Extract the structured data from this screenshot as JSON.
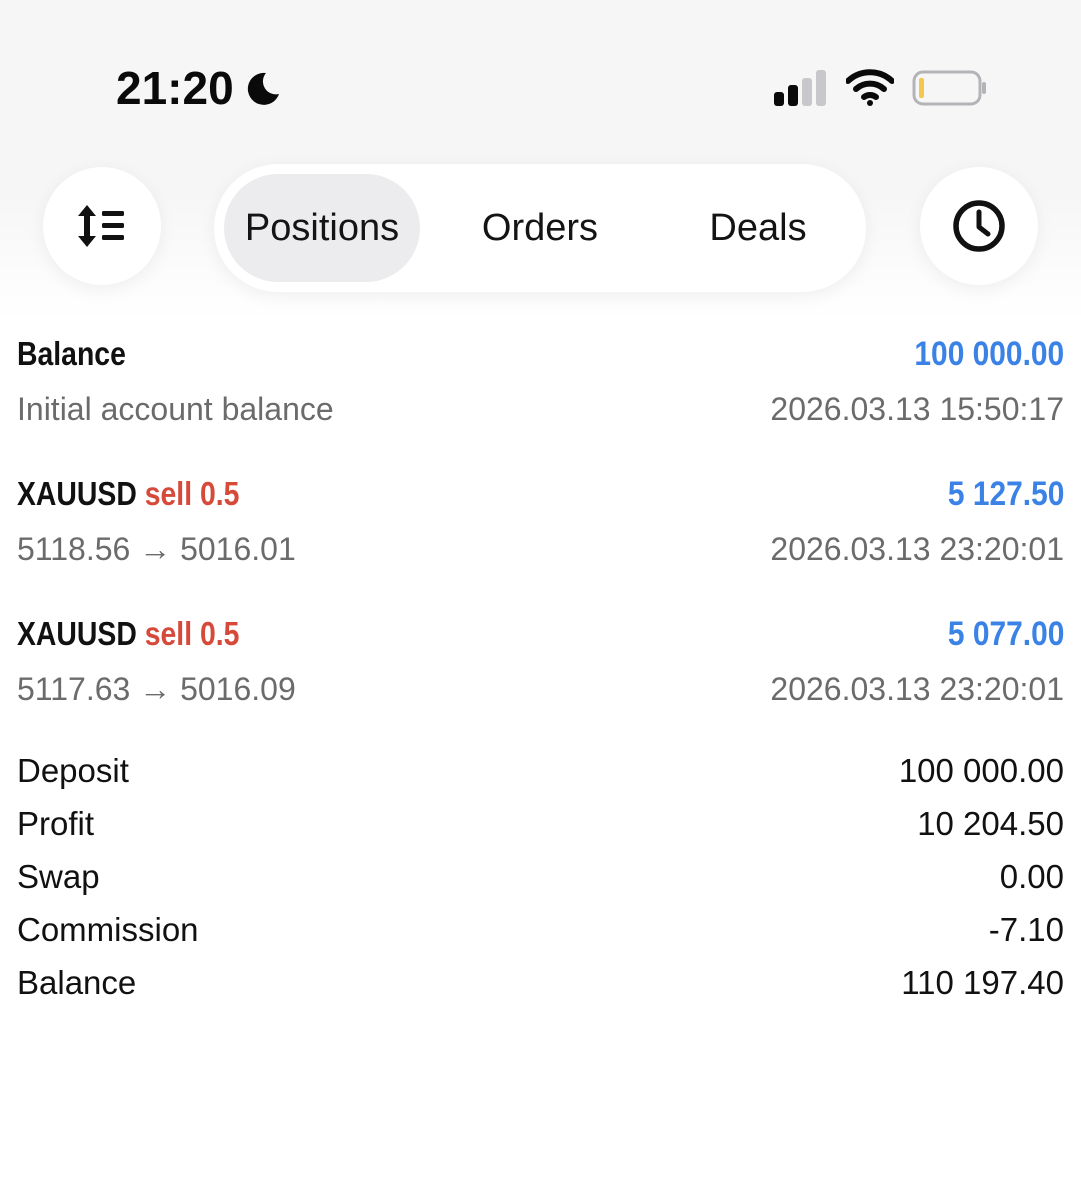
{
  "status_bar": {
    "time": "21:20",
    "icons": [
      "moon-icon",
      "cellular-signal-icon",
      "wifi-icon",
      "battery-icon"
    ]
  },
  "toolbar": {
    "sort_icon": "sort-icon",
    "history_icon": "clock-icon",
    "tabs": [
      {
        "label": "Positions",
        "selected": true
      },
      {
        "label": "Orders",
        "selected": false
      },
      {
        "label": "Deals",
        "selected": false
      }
    ]
  },
  "entries": [
    {
      "title": "Balance",
      "side": "",
      "volume": "",
      "amount": "100 000.00",
      "subtitle": "Initial account balance",
      "timestamp": "2026.03.13 15:50:17"
    },
    {
      "title": "XAUUSD",
      "side": "sell",
      "volume": "0.5",
      "amount": "5 127.50",
      "subtitle": "5118.56 → 5016.01",
      "timestamp": "2026.03.13 23:20:01"
    },
    {
      "title": "XAUUSD",
      "side": "sell",
      "volume": "0.5",
      "amount": "5 077.00",
      "subtitle": "5117.63 → 5016.09",
      "timestamp": "2026.03.13 23:20:01"
    }
  ],
  "summary": [
    {
      "label": "Deposit",
      "value": "100 000.00"
    },
    {
      "label": "Profit",
      "value": "10 204.50"
    },
    {
      "label": "Swap",
      "value": "0.00"
    },
    {
      "label": "Commission",
      "value": "-7.10"
    },
    {
      "label": "Balance",
      "value": "110 197.40"
    }
  ],
  "colors": {
    "amount": "#3b82e6",
    "sell": "#d64a3a",
    "secondary_text": "#6b6b6b",
    "selected_tab": "#ececee",
    "battery_level": "#f2c94c"
  }
}
